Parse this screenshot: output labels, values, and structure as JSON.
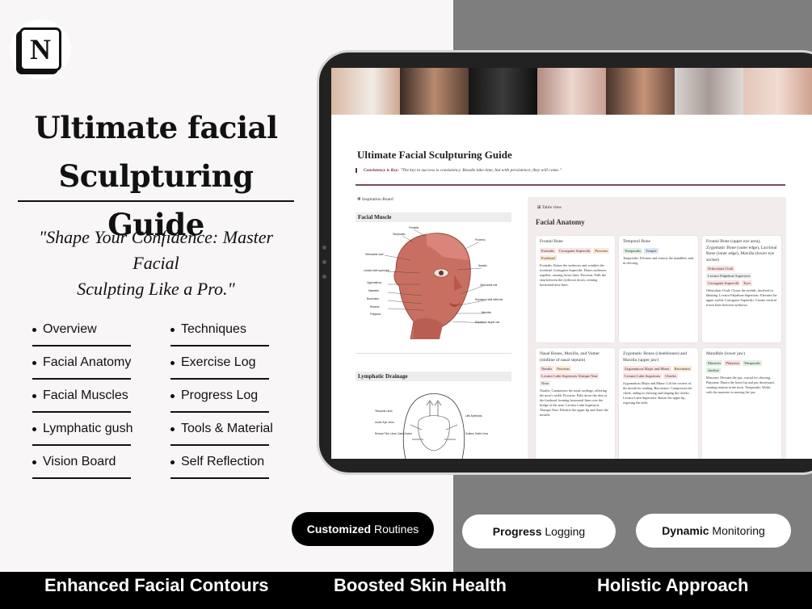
{
  "hero": {
    "title_line1": "Ultimate facial",
    "title_line2": "Sculpturing Guide",
    "quote_line1": "\"Shape Your Confidence: Master Facial",
    "quote_line2": "Sculpting Like a Pro.\""
  },
  "nav": {
    "left": [
      "Overview",
      "Facial Anatomy",
      "Facial Muscles",
      "Lymphatic gush",
      "Vision Board"
    ],
    "right": [
      "Techniques",
      "Exercise Log",
      "Progress Log",
      "Tools & Material",
      "Self Reflection"
    ]
  },
  "notion_logo": "N",
  "app": {
    "page_title": "Ultimate Facial Sculpturing Guide",
    "callout_label": "Consistency is Key:",
    "callout_text": "\"The key to success is consistency. Results take time, but with persistence, they will come.\"",
    "inspiration_label": "Inspiration Board",
    "facial_muscle_heading": "Facial Muscle",
    "lymphatic_heading": "Lymphatic Drainage",
    "table_view_label": "Table view",
    "anatomy_heading": "Facial Anatomy",
    "muscle_labels": [
      "Frontalis",
      "Temporalis",
      "Procerus",
      "Orbicularis oculi",
      "Nasalis",
      "Levator labii superioris",
      "Zygomaticus",
      "Masseter",
      "Buccinator",
      "Risorius",
      "Platysma",
      "Orbicularis oris",
      "Depressor labii inferioris",
      "Mentalis",
      "Depressor anguli oris"
    ],
    "lymph_labels": [
      "Temporal Lines",
      "Under Eye Lines",
      "Reduce Fine Lines, Dark Circles",
      "Lifts Eyebrows",
      "Softens Smile Lines"
    ],
    "cards": [
      {
        "title": "Frontal Bone",
        "tags": [
          {
            "text": "Frontalis",
            "color": "#fde2e2"
          },
          {
            "text": "Corrugator Supercilii",
            "color": "#fde2e2"
          },
          {
            "text": "Procerus",
            "color": "#fbe9d3"
          },
          {
            "text": "Forehead",
            "color": "#fbe9d3"
          }
        ],
        "body": "Frontalis: Raises the eyebrows and wrinkles the forehead. Corrugator Supercilii: Draws eyebrows together, causing frown lines. Procerus: Pulls the skin between the eyebrows down, creating horizontal nose lines."
      },
      {
        "title": "Temporal Bone",
        "tags": [
          {
            "text": "Temporalis",
            "color": "#dff1e3"
          },
          {
            "text": "Temple",
            "color": "#dde8f6"
          }
        ],
        "body": "Temporalis: Elevates and retracts the mandible; aids in chewing"
      },
      {
        "title": "Frontal Bone (upper eye area), Zygomatic Bone (outer edge), Lacrimal Bone (inner edge), Maxilla (lower eye socket)",
        "tags": [
          {
            "text": "Orbicularis Oculi",
            "color": "#fde2e2"
          },
          {
            "text": "Levator Palpebrae Superioris",
            "color": "#efefef"
          },
          {
            "text": "Corrugator Supercilii",
            "color": "#fde2e2"
          },
          {
            "text": "Eyes",
            "color": "#fde2e2"
          }
        ],
        "body": "Orbicularis Oculi: Closes the eyelids, involved in blinking. Levator Palpebrae Superioris: Elevates the upper eyelid. Corrugator Supercilii: Creates vertical frown lines between eyebrows."
      },
      {
        "title": "Nasal Bones, Maxilla, and Vomer (midline of nasal septum)",
        "tags": [
          {
            "text": "Nasalis",
            "color": "#fde2e2"
          },
          {
            "text": "Procerus",
            "color": "#fbe9d3"
          },
          {
            "text": "Levator Labii Superioris Alaeque Nasi",
            "color": "#fde2e2"
          },
          {
            "text": "Nose",
            "color": "#efefef"
          }
        ],
        "body": "Nasalis: Compresses the nasal cartilage, affecting the nose's width. Procerus: Pulls down the skin of the forehead, forming horizontal lines over the bridge of the nose. Levator Labii Superioris Alaeque Nasi: Elevates the upper lip and flares the nostrils."
      },
      {
        "title": "Zygomatic Bones (cheekbones) and Maxilla (upper jaw)",
        "tags": [
          {
            "text": "Zygomaticus Major and Minor",
            "color": "#fde2e2"
          },
          {
            "text": "Buccinator",
            "color": "#fbe9d3"
          },
          {
            "text": "Levator Labii Superioris",
            "color": "#fde2e2"
          },
          {
            "text": "Cheeks",
            "color": "#fde2e2"
          }
        ],
        "body": "Zygomaticus Major and Minor: Lift the corners of the mouth for smiling. Buccinator: Compresses the cheek, aiding in chewing and shaping the cheeks. Levator Labii Superioris: Raises the upper lip, exposing the teeth."
      },
      {
        "title": "Mandible (lower jaw)",
        "tags": [
          {
            "text": "Masseter",
            "color": "#dff1e3"
          },
          {
            "text": "Platysma",
            "color": "#fde2e2"
          },
          {
            "text": "Temporalis",
            "color": "#dff1e3"
          },
          {
            "text": "Jawline",
            "color": "#dff1e3"
          }
        ],
        "body": "Masseter: Elevates the jaw, crucial for chewing. Platysma: Draws the lower lip and jaw downward, creating tension in the neck. Temporalis: Works with the masseter in moving the jaw."
      }
    ]
  },
  "features": {
    "customized_bold": "Customized",
    "customized_rest": " Routines",
    "progress_bold": "Progress",
    "progress_rest": " Logging",
    "dynamic_bold": "Dynamic",
    "dynamic_rest": " Monitoring"
  },
  "bottom": {
    "item1": "Enhanced Facial Contours",
    "item2": "Boosted Skin Health",
    "item3": "Holistic Approach"
  },
  "colors": {
    "accent_rule": "#7d4a55",
    "right_panel": "#7e7e7e",
    "left_panel": "#f8f6f7",
    "muscle": "#c96f62"
  }
}
